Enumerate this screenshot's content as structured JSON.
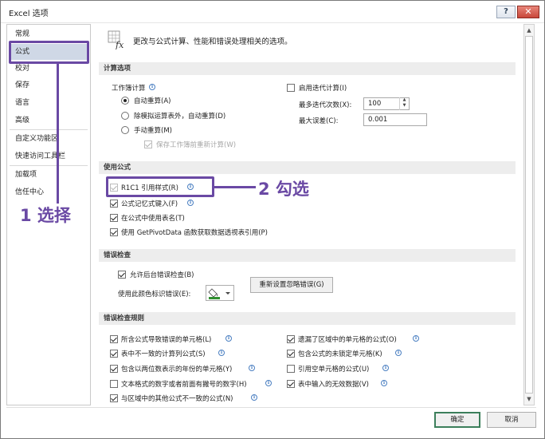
{
  "window": {
    "title": "Excel 选项",
    "help_label": "?",
    "close_label": "✕"
  },
  "sidebar": {
    "items": [
      {
        "label": "常规"
      },
      {
        "label": "公式",
        "active": true
      },
      {
        "label": "校对"
      },
      {
        "label": "保存"
      },
      {
        "label": "语言"
      },
      {
        "label": "高级"
      },
      {
        "label": "自定义功能区"
      },
      {
        "label": "快速访问工具栏"
      },
      {
        "label": "加载项"
      },
      {
        "label": "信任中心"
      }
    ]
  },
  "intro": {
    "icon": "formula-fx-icon",
    "text": "更改与公式计算、性能和错误处理相关的选项。"
  },
  "calc": {
    "title": "计算选项",
    "workbook_calc_label": "工作簿计算",
    "radios": [
      {
        "label": "自动重算(A)",
        "checked": true
      },
      {
        "label": "除模拟运算表外，自动重算(D)",
        "checked": false
      },
      {
        "label": "手动重算(M)",
        "checked": false
      }
    ],
    "save_recalc": {
      "label": "保存工作簿前重新计算(W)",
      "checked": true,
      "disabled": true
    },
    "iterative": {
      "label": "启用迭代计算(I)",
      "checked": false
    },
    "max_iter_label": "最多迭代次数(X):",
    "max_iter_value": "100",
    "max_change_label": "最大误差(C):",
    "max_change_value": "0.001"
  },
  "formulas": {
    "title": "使用公式",
    "items": [
      {
        "label": "R1C1 引用样式(R)",
        "checked": true,
        "disabled": true,
        "info": true
      },
      {
        "label": "公式记忆式键入(F)",
        "checked": true,
        "info": true
      },
      {
        "label": "在公式中使用表名(T)",
        "checked": true,
        "info": false
      },
      {
        "label": "使用 GetPivotData 函数获取数据透视表引用(P)",
        "checked": true,
        "info": false
      }
    ]
  },
  "error_checking": {
    "title": "错误检查",
    "background_label": "允许后台错误检查(B)",
    "background_checked": true,
    "color_label": "使用此颜色标识错误(E):",
    "reset_button": "重新设置忽略错误(G)"
  },
  "rules": {
    "title": "错误检查规则",
    "left": [
      {
        "label": "所含公式导致错误的单元格(L)",
        "checked": true
      },
      {
        "label": "表中不一致的计算列公式(S)",
        "checked": true
      },
      {
        "label": "包含以两位数表示的年份的单元格(Y)",
        "checked": true
      },
      {
        "label": "文本格式的数字或者前面有撇号的数字(H)",
        "checked": false
      },
      {
        "label": "与区域中的其他公式不一致的公式(N)",
        "checked": true
      }
    ],
    "right": [
      {
        "label": "遗漏了区域中的单元格的公式(O)",
        "checked": true
      },
      {
        "label": "包含公式的未锁定单元格(K)",
        "checked": true
      },
      {
        "label": "引用空单元格的公式(U)",
        "checked": false
      },
      {
        "label": "表中输入的无效数据(V)",
        "checked": true
      }
    ]
  },
  "footer": {
    "ok": "确定",
    "cancel": "取消"
  },
  "annotations": {
    "step1": "1 选择",
    "step2": "2 勾选",
    "color": "#6a49a4"
  },
  "colors": {
    "accent": "#6a49a4",
    "sidebar_active": "#cfd8e6",
    "section_bg": "#ededed",
    "ok_border": "#3c7f5b"
  }
}
